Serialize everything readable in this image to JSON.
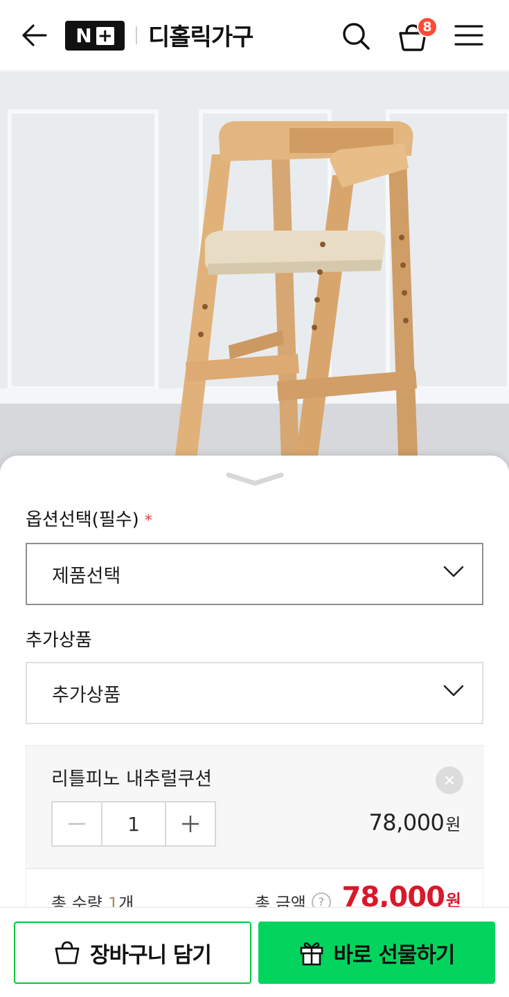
{
  "header": {
    "logo_n": "N",
    "logo_plus": "+",
    "store_name": "디홀릭가구",
    "cart_count": "8",
    "icons": [
      "back-arrow-icon",
      "search-icon",
      "cart-basket-icon",
      "menu-icon"
    ]
  },
  "options": {
    "option_label": "옵션선택(필수)",
    "required_mark": "*",
    "product_select_value": "제품선택",
    "extra_label": "추가상품",
    "extra_select_value": "추가상품"
  },
  "selected_item": {
    "name": "리틀피노 내추럴쿠션",
    "quantity": "1",
    "price": "78,000",
    "currency": "원"
  },
  "totals": {
    "qty_label": "총 수량",
    "qty_value": "1",
    "qty_unit": "개",
    "amount_label": "총 금액",
    "amount_help": "?",
    "amount_value": "78,000",
    "currency": "원"
  },
  "actions": {
    "add_to_cart_label": "장바구니 담기",
    "gift_label": "바로 선물하기"
  },
  "colors": {
    "accent_green": "#03d45e",
    "price_red": "#d7192b",
    "badge_red": "#ff4a36"
  }
}
